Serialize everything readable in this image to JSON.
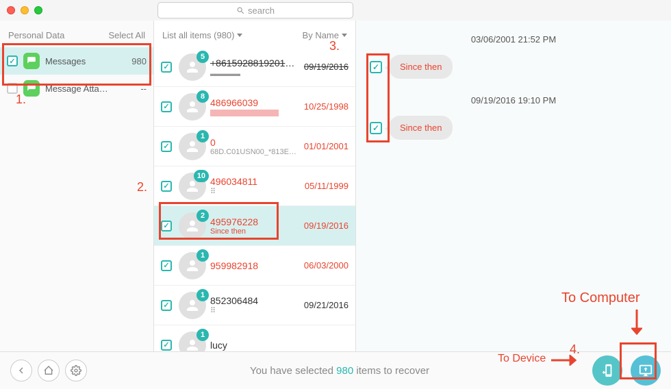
{
  "search": {
    "placeholder": "search"
  },
  "sidebar": {
    "header_left": "Personal Data",
    "header_right": "Select All",
    "items": [
      {
        "label": "Messages",
        "count": "980",
        "checked": true,
        "selected": true
      },
      {
        "label": "Message Atta…",
        "count": "--",
        "checked": false,
        "selected": false
      }
    ]
  },
  "list_header": {
    "left": "List all items (980)",
    "right": "By Name"
  },
  "conversations": [
    {
      "badge": "5",
      "name": "+8615928819201、…",
      "name_red": false,
      "name_strike": true,
      "preview": "▬▬▬▬",
      "preview_red": false,
      "date": "09/19/2016",
      "date_strike": true,
      "date_red": false,
      "selected": false
    },
    {
      "badge": "8",
      "name": "486966039",
      "name_red": true,
      "preview_redacted": true,
      "date": "10/25/1998",
      "date_red": true,
      "selected": false
    },
    {
      "badge": "1",
      "name": "0",
      "name_red": true,
      "preview": "68D.C01USN00_*813E…",
      "date": "01/01/2001",
      "date_red": true,
      "selected": false
    },
    {
      "badge": "10",
      "name": "496034811",
      "name_red": true,
      "preview": "⠿",
      "date": "05/11/1999",
      "date_red": true,
      "selected": false
    },
    {
      "badge": "2",
      "name": "495976228",
      "name_red": true,
      "preview": "Since then",
      "preview_red": true,
      "date": "09/19/2016",
      "date_red": true,
      "selected": true
    },
    {
      "badge": "1",
      "name": "959982918",
      "name_red": true,
      "preview": "",
      "date": "06/03/2000",
      "date_red": true,
      "selected": false
    },
    {
      "badge": "1",
      "name": "852306484",
      "name_red": false,
      "preview": "⠿",
      "date": "09/21/2016",
      "date_red": false,
      "selected": false
    },
    {
      "badge": "1",
      "name": "lucy",
      "name_red": false,
      "preview": "",
      "date": "",
      "date_red": false,
      "selected": false
    }
  ],
  "detail": {
    "timestamps": [
      "03/06/2001 21:52 PM",
      "09/19/2016 19:10 PM"
    ],
    "messages": [
      {
        "text": "Since then"
      },
      {
        "text": "Since then"
      }
    ]
  },
  "footer": {
    "status_prefix": "You have selected ",
    "status_count": "980",
    "status_suffix": " items to recover"
  },
  "annotations": {
    "n1": "1.",
    "n2": "2.",
    "n3": "3.",
    "n4": "4.",
    "to_device": "To Device",
    "to_computer": "To Computer"
  }
}
